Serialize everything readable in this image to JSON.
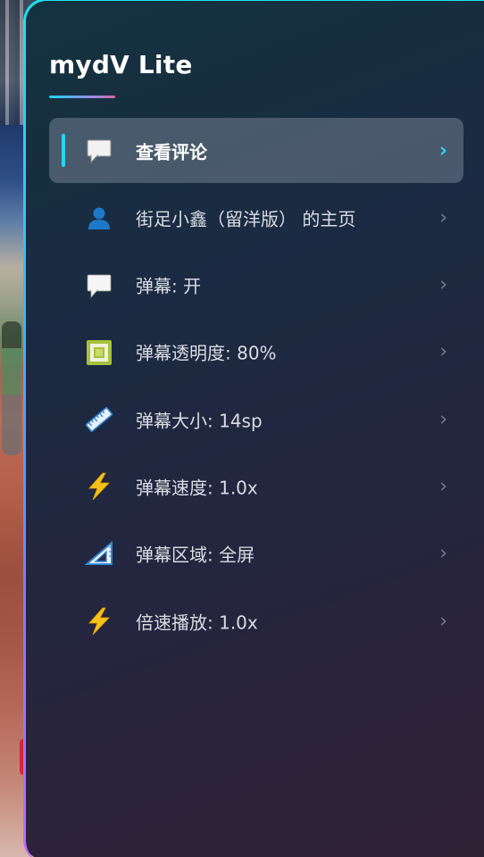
{
  "app": {
    "title": "mydV Lite"
  },
  "menu": {
    "items": [
      {
        "label": "查看评论",
        "icon": "comment-bubble-icon",
        "active": true,
        "chevron": "›"
      },
      {
        "label": "街足小鑫（留洋版） 的主页",
        "icon": "user-profile-icon",
        "active": false,
        "chevron": "›"
      },
      {
        "label": "弹幕: 开",
        "icon": "danmaku-bubble-icon",
        "active": false,
        "chevron": "›"
      },
      {
        "label": "弹幕透明度: 80%",
        "icon": "opacity-square-icon",
        "active": false,
        "chevron": "›"
      },
      {
        "label": "弹幕大小: 14sp",
        "icon": "ruler-icon",
        "active": false,
        "chevron": "›"
      },
      {
        "label": "弹幕速度: 1.0x",
        "icon": "lightning-icon",
        "active": false,
        "chevron": "›"
      },
      {
        "label": "弹幕区域: 全屏",
        "icon": "triangle-ruler-icon",
        "active": false,
        "chevron": "›"
      },
      {
        "label": "倍速播放: 1.0x",
        "icon": "lightning-icon",
        "active": false,
        "chevron": "›"
      }
    ]
  },
  "colors": {
    "accent": "#24d6f0",
    "active_bg": "#5a6474",
    "text": "#d9dce3"
  }
}
